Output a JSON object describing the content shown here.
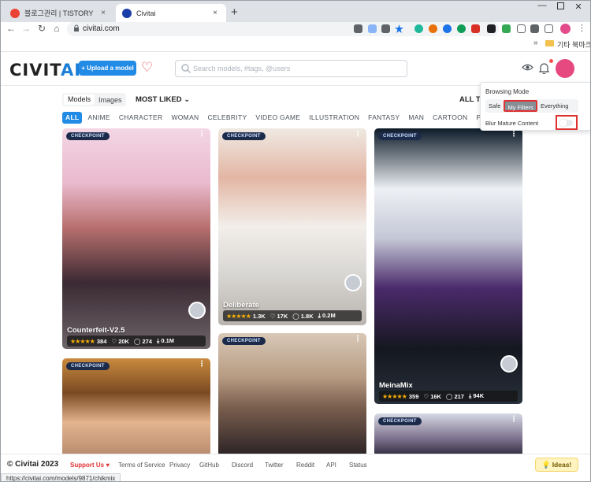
{
  "browser": {
    "tabs": [
      {
        "title": "블로그관리 | TISTORY",
        "close": "×"
      },
      {
        "title": "Civitai",
        "close": "×"
      }
    ],
    "new_tab": "+",
    "url": "civitai.com",
    "bookmarks_more": "»",
    "bookmarks_folder": "기타 북마크",
    "status_url": "https://civitai.com/models/9871/chikmix"
  },
  "header": {
    "logo_main": "CIVIT",
    "logo_accent": "AI",
    "upload_label": "+ Upload a model",
    "search_placeholder": "Search models, #tags, @users"
  },
  "browsing_mode": {
    "title": "Browsing Mode",
    "options": [
      "Safe",
      "My Filters",
      "Everything"
    ],
    "selected": "My Filters",
    "blur_label": "Blur Mature Content",
    "blur_enabled": false
  },
  "controls": {
    "mode_tabs": [
      "Models",
      "Images"
    ],
    "active_mode": "Models",
    "sort_label": "MOST LIKED",
    "period_label": "ALL TI"
  },
  "categories": [
    "ALL",
    "ANIME",
    "CHARACTER",
    "WOMAN",
    "CELEBRITY",
    "VIDEO GAME",
    "ILLUSTRATION",
    "FANTASY",
    "MAN",
    "CARTOON",
    "PHO"
  ],
  "cards": [
    {
      "badge": "CHECKPOINT",
      "name": "Counterfeit-V2.5",
      "rating": "384",
      "likes": "20K",
      "comments": "274",
      "downloads": "0.1M"
    },
    {
      "badge": "CHECKPOINT",
      "name": "Deliberate",
      "rating": "1.3K",
      "likes": "17K",
      "comments": "1.8K",
      "downloads": "0.2M"
    },
    {
      "badge": "CHECKPOINT",
      "name": "MeinaMix",
      "rating": "359",
      "likes": "16K",
      "comments": "217",
      "downloads": "94K"
    },
    {
      "badge": "CHECKPOINT",
      "name": ""
    },
    {
      "badge": "CHECKPOINT",
      "name": ""
    },
    {
      "badge": "CHECKPOINT",
      "name": ""
    }
  ],
  "footer": {
    "copyright": "© Civitai 2023",
    "support": "Support Us",
    "links": [
      "Terms of Service",
      "Privacy",
      "GitHub",
      "Discord",
      "Twitter",
      "Reddit",
      "API",
      "Status"
    ],
    "ideas": "Ideas!"
  },
  "colors": {
    "accent": "#228be6",
    "badge_bg": "#1c2b4a",
    "highlight": "#e03131",
    "heart": "#e8414e"
  }
}
